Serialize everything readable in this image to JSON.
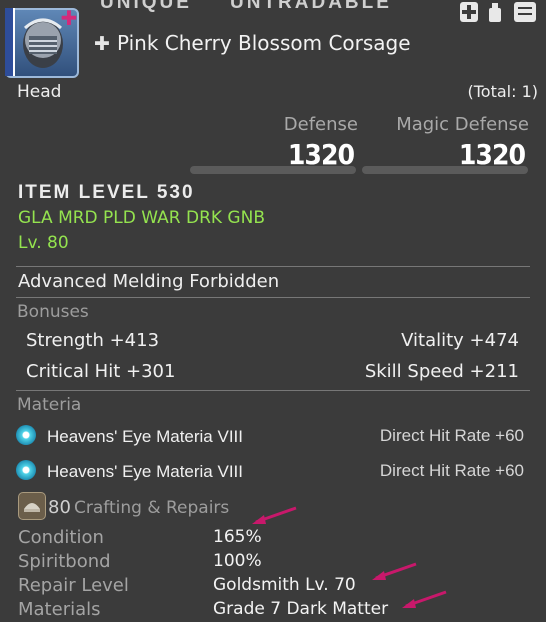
{
  "flags": {
    "unique": "UNIQUE",
    "untradable": "UNTRADABLE"
  },
  "header_icons": [
    "plus-shield-icon",
    "dye-bottle-icon",
    "armoire-icon"
  ],
  "item": {
    "name": "Pink Cherry Blossom Corsage",
    "crafted_symbol": "✚",
    "slot": "Head",
    "total": "(Total: 1)",
    "glamour_mark": "✚"
  },
  "stats": {
    "defense_label": "Defense",
    "defense_value": "1320",
    "magic_defense_label": "Magic Defense",
    "magic_defense_value": "1320"
  },
  "item_level": "ITEM LEVEL 530",
  "jobs": "GLA MRD PLD WAR DRK GNB",
  "level": "Lv. 80",
  "melding": "Advanced Melding Forbidden",
  "bonuses": {
    "title": "Bonuses",
    "items": [
      {
        "left": "Strength +413",
        "right": "Vitality +474"
      },
      {
        "left": "Critical Hit +301",
        "right": "Skill Speed +211"
      }
    ]
  },
  "materia": {
    "title": "Materia",
    "items": [
      {
        "name": "Heavens' Eye Materia VIII",
        "stat": "Direct Hit Rate +60"
      },
      {
        "name": "Heavens' Eye Materia VIII",
        "stat": "Direct Hit Rate +60"
      }
    ]
  },
  "crafting": {
    "level": "80",
    "title": "Crafting & Repairs",
    "rows": [
      {
        "label": "Condition",
        "value": "165%"
      },
      {
        "label": "Spiritbond",
        "value": "100%"
      },
      {
        "label": "Repair Level",
        "value": "Goldsmith Lv. 70"
      },
      {
        "label": "Materials",
        "value": "Grade 7 Dark Matter"
      }
    ]
  },
  "colors": {
    "background": "#3b3b3b",
    "job_text": "#94e34f",
    "annotation_arrow": "#c8186b",
    "glamour_mark": "#d42a7b"
  }
}
